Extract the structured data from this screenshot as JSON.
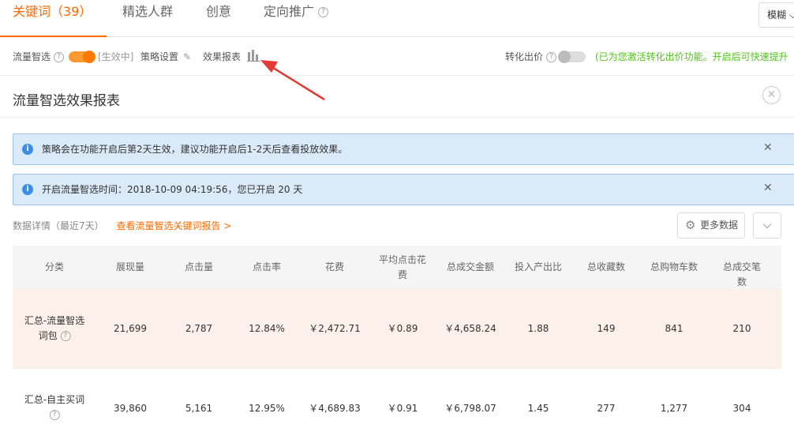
{
  "tabs": [
    {
      "label": "关键词（39）",
      "active": true
    },
    {
      "label": "精选人群"
    },
    {
      "label": "创意"
    },
    {
      "label": "定向推广"
    }
  ],
  "mode_select": {
    "value": "模糊"
  },
  "toolbar": {
    "smart_traffic_label": "流量智选",
    "status": "[生效中]",
    "strategy_label": "策略设置",
    "report_label": "效果报表",
    "conversion_bid_label": "转化出价",
    "conversion_bid_hint": "(已为您激活转化出价功能。开启后可快速提升"
  },
  "panel": {
    "title": "流量智选效果报表"
  },
  "alerts": [
    {
      "text": "策略会在功能开启后第2天生效，建议功能开启后1-2天后查看投放效果。"
    },
    {
      "text": "开启流量智选时间：2018-10-09 04:19:56，您已开启 20 天"
    }
  ],
  "details": {
    "title": "数据详情（最近7天）",
    "link": "查看流量智选关键词报告 >",
    "more_button": "更多数据"
  },
  "table": {
    "headers": [
      "分类",
      "展现量",
      "点击量",
      "点击率",
      "花费",
      "平均点击花费",
      "总成交金额",
      "投入产出比",
      "总收藏数",
      "总购物车数",
      "总成交笔数"
    ],
    "rows": [
      {
        "category_line1": "汇总-流量智选",
        "category_line2": "词包",
        "cells": [
          "21,699",
          "2,787",
          "12.84%",
          "￥2,472.71",
          "￥0.89",
          "￥4,658.24",
          "1.88",
          "149",
          "841",
          "210"
        ]
      },
      {
        "category_line1": "汇总-自主买词",
        "category_line2": "",
        "cells": [
          "39,860",
          "5,161",
          "12.95%",
          "￥4,689.83",
          "￥0.91",
          "￥6,798.07",
          "1.45",
          "277",
          "1,277",
          "304"
        ]
      }
    ]
  },
  "colors": {
    "accent": "#ff6a00",
    "info_bg": "#dbeaf9",
    "highlight_row": "#fbf0ea",
    "annotation_arrow": "#e53935"
  }
}
